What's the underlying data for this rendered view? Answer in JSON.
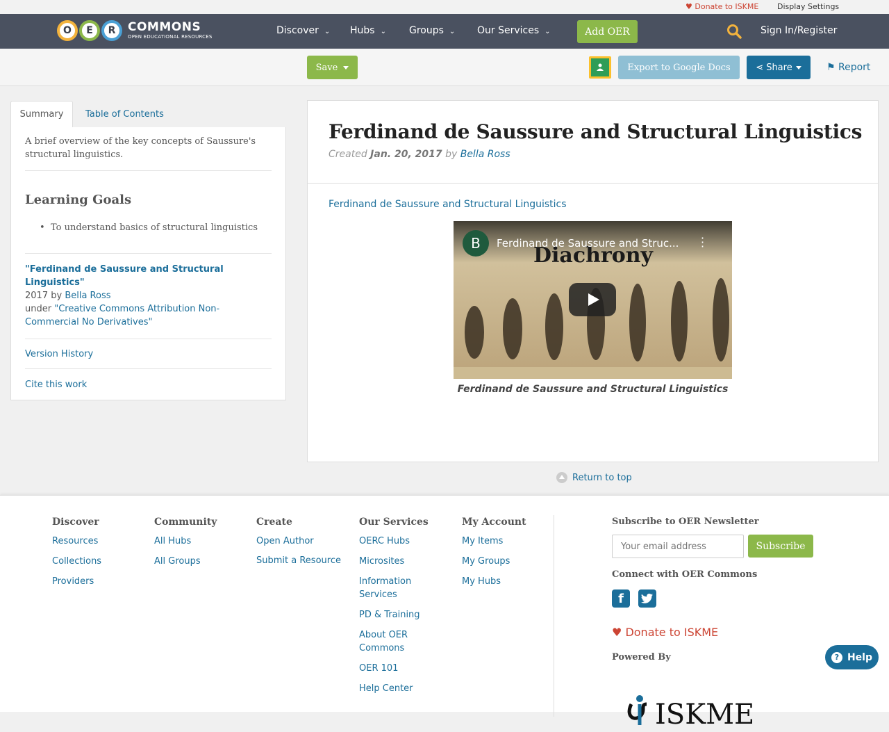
{
  "utility": {
    "donate": "Donate to ISKME",
    "display_settings": "Display Settings"
  },
  "logo": {
    "letters": [
      "O",
      "E",
      "R"
    ],
    "title": "COMMONS",
    "subtitle": "OPEN EDUCATIONAL RESOURCES"
  },
  "nav": {
    "items": [
      "Discover",
      "Hubs",
      "Groups",
      "Our Services"
    ],
    "add_oer": "Add OER",
    "sign_in": "Sign In/Register"
  },
  "toolbar": {
    "save": "Save",
    "export": "Export to Google Docs",
    "share": "Share",
    "report": "Report"
  },
  "sidebar": {
    "tabs": [
      "Summary",
      "Table of Contents"
    ],
    "summary": "A brief overview of the key concepts of Saussure's structural linguistics.",
    "learning_goals_title": "Learning Goals",
    "goals": [
      "To understand basics of structural linguistics"
    ],
    "attribution": {
      "title": "\"Ferdinand de Saussure and Structural Linguistics\"",
      "year_by": "2017 by",
      "author": "Bella Ross",
      "under": "under",
      "license": "\"Creative Commons Attribution Non-Commercial No Derivatives\""
    },
    "version_history": "Version History",
    "cite": "Cite this work"
  },
  "resource": {
    "title": "Ferdinand de Saussure and Structural Linguistics",
    "created_label": "Created",
    "created_date": "Jan. 20, 2017",
    "by": "by",
    "author": "Bella Ross",
    "link_text": "Ferdinand de Saussure and Structural Linguistics",
    "video": {
      "channel_initial": "B",
      "title": "Ferdinand de Saussure and Struc...",
      "overlay_text": "Diachrony"
    },
    "caption": "Ferdinand de Saussure and Structural Linguistics"
  },
  "return_top": "Return to top",
  "footer": {
    "columns": [
      {
        "title": "Discover",
        "links": [
          "Resources",
          "Collections",
          "Providers"
        ]
      },
      {
        "title": "Community",
        "links": [
          "All Hubs",
          "All Groups"
        ]
      },
      {
        "title": "Create",
        "links": [
          "Open Author",
          "Submit a Resource"
        ]
      },
      {
        "title": "Our Services",
        "links": [
          "OERC Hubs",
          "Microsites",
          "Information Services",
          "PD & Training",
          "About OER Commons",
          "OER 101",
          "Help Center"
        ]
      },
      {
        "title": "My Account",
        "links": [
          "My Items",
          "My Groups",
          "My Hubs"
        ]
      }
    ],
    "newsletter_title": "Subscribe to OER Newsletter",
    "email_placeholder": "Your email address",
    "subscribe": "Subscribe",
    "connect_title": "Connect with OER Commons",
    "donate": "Donate to ISKME",
    "powered_by": "Powered By",
    "iskme_logo": "ISKME"
  },
  "help": "Help",
  "colors": {
    "nav_bg": "#4a5160",
    "green": "#8cb84a",
    "blue": "#1b6e9a",
    "donate_red": "#cc4433"
  }
}
